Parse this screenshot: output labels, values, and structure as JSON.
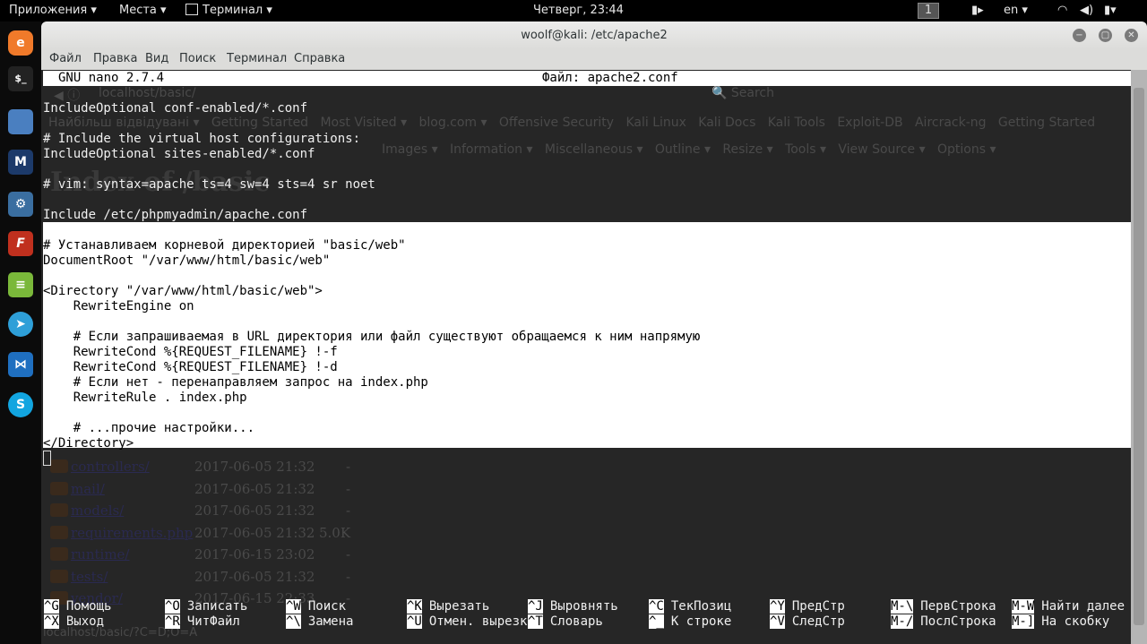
{
  "topbar": {
    "apps": "Приложения ▾",
    "places": "Места ▾",
    "terminal": "Терминал ▾",
    "clock": "Четверг, 23:44",
    "workspace": "1",
    "lang": "en ▾"
  },
  "window": {
    "title": "woolf@kali: /etc/apache2",
    "menu": [
      "Файл",
      "Правка",
      "Вид",
      "Поиск",
      "Терминал",
      "Справка"
    ]
  },
  "browser": {
    "address": "localhost/basic/",
    "search": "Search",
    "bookmarks": [
      "Найбільш відвідувані ▾",
      "Getting Started",
      "Most Visited ▾",
      "blog.com ▾",
      "Offensive Security",
      "Kali Linux",
      "Kali Docs",
      "Kali Tools",
      "Exploit-DB",
      "Aircrack-ng",
      "Getting Started"
    ],
    "devtools": [
      "Images ▾",
      "Information ▾",
      "Miscellaneous ▾",
      "Outline ▾",
      "Resize ▾",
      "Tools ▾",
      "View Source ▾",
      "Options ▾"
    ],
    "heading": "Index of /basic",
    "listing": [
      {
        "name": "controllers/",
        "date": "2017-06-05 21:32",
        "size": "-"
      },
      {
        "name": "mail/",
        "date": "2017-06-05 21:32",
        "size": "-"
      },
      {
        "name": "models/",
        "date": "2017-06-05 21:32",
        "size": "-"
      },
      {
        "name": "requirements.php",
        "date": "2017-06-05 21:32",
        "size": "5.0K"
      },
      {
        "name": "runtime/",
        "date": "2017-06-15 23:02",
        "size": "-"
      },
      {
        "name": "tests/",
        "date": "2017-06-05 21:32",
        "size": "-"
      },
      {
        "name": "vendor/",
        "date": "2017-06-15 22:33",
        "size": "-"
      }
    ],
    "status": "localhost/basic/?C=D;O=A"
  },
  "nano": {
    "version": "GNU nano 2.7.4",
    "file": "Файл: apache2.conf",
    "lines": [
      "",
      "IncludeOptional conf-enabled/*.conf",
      "",
      "# Include the virtual host configurations:",
      "IncludeOptional sites-enabled/*.conf",
      "",
      "# vim: syntax=apache ts=4 sw=4 sts=4 sr noet",
      "",
      "Include /etc/phpmyadmin/apache.conf"
    ],
    "selected": [
      "",
      "# Устанавливаем корневой директорией \"basic/web\"",
      "DocumentRoot \"/var/www/html/basic/web\"",
      "",
      "<Directory \"/var/www/html/basic/web\">",
      "    RewriteEngine on",
      "",
      "    # Если запрашиваемая в URL директория или файл существуют обращаемся к ним напрямую",
      "    RewriteCond %{REQUEST_FILENAME} !-f",
      "    RewriteCond %{REQUEST_FILENAME} !-d",
      "    # Если нет - перенаправляем запрос на index.php",
      "    RewriteRule . index.php",
      "",
      "    # ...прочие настройки...",
      "</Directory>"
    ],
    "shortcuts": [
      [
        {
          "k": "^G",
          "l": "Помощь"
        },
        {
          "k": "^X",
          "l": "Выход"
        }
      ],
      [
        {
          "k": "^O",
          "l": "Записать"
        },
        {
          "k": "^R",
          "l": "ЧитФайл"
        }
      ],
      [
        {
          "k": "^W",
          "l": "Поиск"
        },
        {
          "k": "^\\",
          "l": "Замена"
        }
      ],
      [
        {
          "k": "^K",
          "l": "Вырезать"
        },
        {
          "k": "^U",
          "l": "Отмен. вырезк"
        }
      ],
      [
        {
          "k": "^J",
          "l": "Выровнять"
        },
        {
          "k": "^T",
          "l": "Словарь"
        }
      ],
      [
        {
          "k": "^C",
          "l": "ТекПозиц"
        },
        {
          "k": "^_",
          "l": "К строке"
        }
      ],
      [
        {
          "k": "^Y",
          "l": "ПредСтр"
        },
        {
          "k": "^V",
          "l": "СледСтр"
        }
      ],
      [
        {
          "k": "M-\\",
          "l": "ПервСтрока"
        },
        {
          "k": "M-/",
          "l": "ПослСтрока"
        }
      ],
      [
        {
          "k": "M-W",
          "l": "Найти далее"
        },
        {
          "k": "M-]",
          "l": "На скобку"
        }
      ]
    ]
  }
}
